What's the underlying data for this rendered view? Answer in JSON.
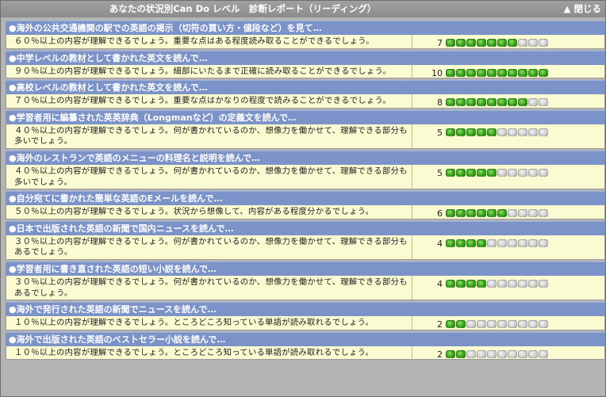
{
  "header": {
    "title": "あなたの状況別Can Do レベル　診断レポート（リーディング）",
    "close_label": "▲ 閉じる"
  },
  "max_score": 10,
  "items": [
    {
      "heading": "●海外の公共交通機関の駅での英語の掲示（切符の買い方・値段など）を見て…",
      "description": "６０％以上の内容が理解できるでしょう。重要な点はある程度読み取ることができるでしょう。",
      "score": 7
    },
    {
      "heading": "●中学レベルの教材として書かれた英文を読んで…",
      "description": "９０％以上の内容が理解できるでしょう。細部にいたるまで正確に読み取ることができるでしょう。",
      "score": 10
    },
    {
      "heading": "●高校レベルの教材として書かれた英文を読んで…",
      "description": "７０％以上の内容が理解できるでしょう。重要な点はかなりの程度で読みることができるでしょう。",
      "score": 8
    },
    {
      "heading": "●学習者用に編纂された英英辞典（Longmanなど）の定義文を読んで…",
      "description": "４０％以上の内容が理解できるでしょう。何が書かれているのか、想像力を働かせて、理解できる部分も多いでしょう。",
      "score": 5
    },
    {
      "heading": "●海外のレストランで英語のメニューの料理名と説明を読んで…",
      "description": "４０％以上の内容が理解できるでしょう。何が書かれているのか、想像力を働かせて、理解できる部分も多いでしょう。",
      "score": 5
    },
    {
      "heading": "●自分宛てに書かれた簡単な英語のEメールを読んで…",
      "description": "５０％以上の内容が理解できるでしょう。状況から想像して、内容がある程度分かるでしょう。",
      "score": 6
    },
    {
      "heading": "●日本で出版された英語の新聞で国内ニュースを読んで…",
      "description": "３０％以上の内容が理解できるでしょう。何が書かれているのか、想像力を働かせて、理解できる部分もあるでしょう。",
      "score": 4
    },
    {
      "heading": "●学習者用に書き直された英語の短い小説を読んで…",
      "description": "３０％以上の内容が理解できるでしょう。何が書かれているのか、想像力を働かせて、理解できる部分もあるでしょう。",
      "score": 4
    },
    {
      "heading": "●海外で発行された英語の新聞でニュースを読んで…",
      "description": "１０％以上の内容が理解できるでしょう。ところどころ知っている単語が読み取れるでしょう。",
      "score": 2
    },
    {
      "heading": "●海外で出版された英語のベストセラー小説を読んで…",
      "description": "１０％以上の内容が理解できるでしょう。ところどころ知っている単語が読み取れるでしょう。",
      "score": 2
    }
  ]
}
